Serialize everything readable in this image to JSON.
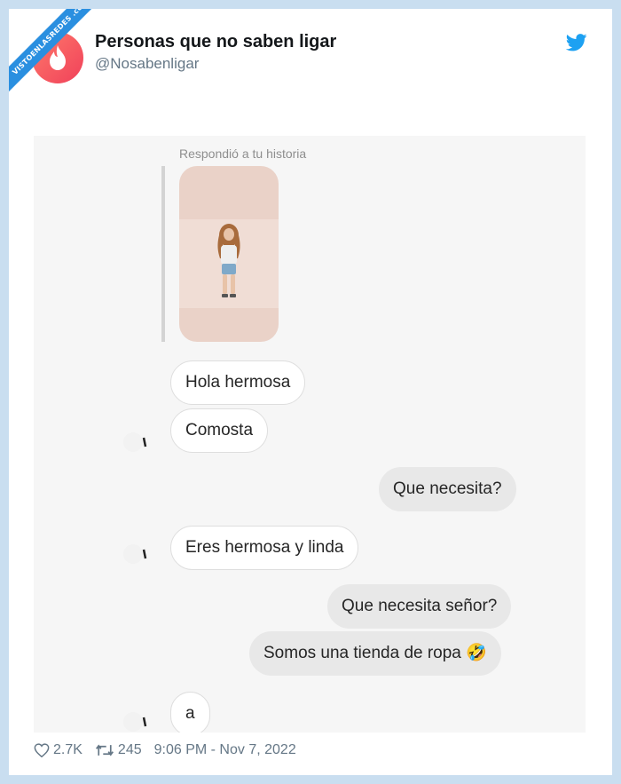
{
  "ribbon": {
    "text": "VISTOENLASREDES .com"
  },
  "tweet": {
    "display_name": "Personas que no saben ligar",
    "handle": "@Nosabenligar",
    "likes": "2.7K",
    "retweets": "245",
    "timestamp": "9:06 PM - Nov 7, 2022"
  },
  "chat": {
    "replied_label": "Respondió a tu historia",
    "messages": [
      {
        "side": "in",
        "text": "Hola hermosa"
      },
      {
        "side": "in",
        "text": "Comosta"
      },
      {
        "side": "out",
        "text": "Que necesita?"
      },
      {
        "side": "in",
        "text": "Eres hermosa y linda"
      },
      {
        "side": "out",
        "text": "Que necesita señor?"
      },
      {
        "side": "out",
        "text": "Somos una tienda de ropa 🤣"
      },
      {
        "side": "in",
        "text": "a"
      }
    ]
  },
  "colors": {
    "twitter_blue": "#1da1f2",
    "ribbon_blue": "#2a8fe0",
    "avatar_red": "#f0415a"
  },
  "icons": {
    "avatar": "flame-icon",
    "brand": "twitter-bird-icon",
    "likes": "heart-icon",
    "retweets": "retweet-icon"
  }
}
